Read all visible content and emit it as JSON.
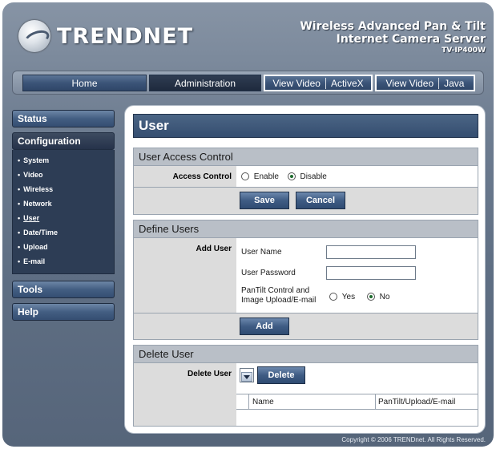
{
  "header": {
    "logo_text": "TRENDNET",
    "product_line1": "Wireless Advanced Pan & Tilt",
    "product_line2": "Internet Camera Server",
    "model": "TV-IP400W"
  },
  "topnav": {
    "home": "Home",
    "administration": "Administration",
    "view_video_1": "View Video",
    "activex": "ActiveX",
    "view_video_2": "View Video",
    "java": "Java"
  },
  "sidebar": {
    "status": "Status",
    "configuration": "Configuration",
    "items": [
      {
        "label": "System"
      },
      {
        "label": "Video"
      },
      {
        "label": "Wireless"
      },
      {
        "label": "Network"
      },
      {
        "label": "User"
      },
      {
        "label": "Date/Time"
      },
      {
        "label": "Upload"
      },
      {
        "label": "E-mail"
      }
    ],
    "tools": "Tools",
    "help": "Help",
    "bullet": "•"
  },
  "page": {
    "title": "User"
  },
  "access": {
    "heading": "User Access Control",
    "label": "Access Control",
    "enable": "Enable",
    "disable": "Disable",
    "selected": "Disable",
    "save": "Save",
    "cancel": "Cancel"
  },
  "define": {
    "heading": "Define Users",
    "label": "Add User",
    "user_name": "User Name",
    "user_password": "User Password",
    "pantilt_line1": "PanTilt Control and",
    "pantilt_line2": "Image Upload/E-mail",
    "yes": "Yes",
    "no": "No",
    "selected": "No",
    "add": "Add"
  },
  "delete": {
    "heading": "Delete User",
    "label": "Delete User",
    "button": "Delete",
    "col_name": "Name",
    "col_perm": "PanTilt/Upload/E-mail"
  },
  "footer": "Copyright © 2006 TRENDnet. All Rights Reserved."
}
